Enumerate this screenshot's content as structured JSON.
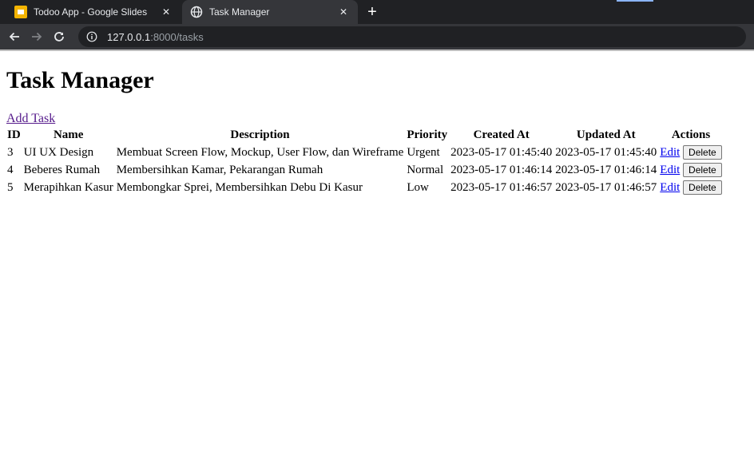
{
  "browser": {
    "tabs": [
      {
        "title": "Todoo App - Google Slides",
        "icon": "google-slides-icon",
        "active": false
      },
      {
        "title": "Task Manager",
        "icon": "globe-icon",
        "active": true
      }
    ],
    "address": {
      "host": "127.0.0.1",
      "path": ":8000/tasks"
    }
  },
  "page": {
    "heading": "Task Manager",
    "add_link": "Add Task",
    "columns": [
      "ID",
      "Name",
      "Description",
      "Priority",
      "Created At",
      "Updated At",
      "Actions"
    ],
    "rows": [
      {
        "id": "3",
        "name": "UI UX Design",
        "description": "Membuat Screen Flow, Mockup, User Flow, dan Wireframe",
        "priority": "Urgent",
        "created": "2023-05-17 01:45:40",
        "updated": "2023-05-17 01:45:40"
      },
      {
        "id": "4",
        "name": "Beberes Rumah",
        "description": "Membersihkan Kamar, Pekarangan Rumah",
        "priority": "Normal",
        "created": "2023-05-17 01:46:14",
        "updated": "2023-05-17 01:46:14"
      },
      {
        "id": "5",
        "name": "Merapihkan Kasur",
        "description": "Membongkar Sprei, Membersihkan Debu Di Kasur",
        "priority": "Low",
        "created": "2023-05-17 01:46:57",
        "updated": "2023-05-17 01:46:57"
      }
    ],
    "edit_label": "Edit",
    "delete_label": "Delete"
  }
}
